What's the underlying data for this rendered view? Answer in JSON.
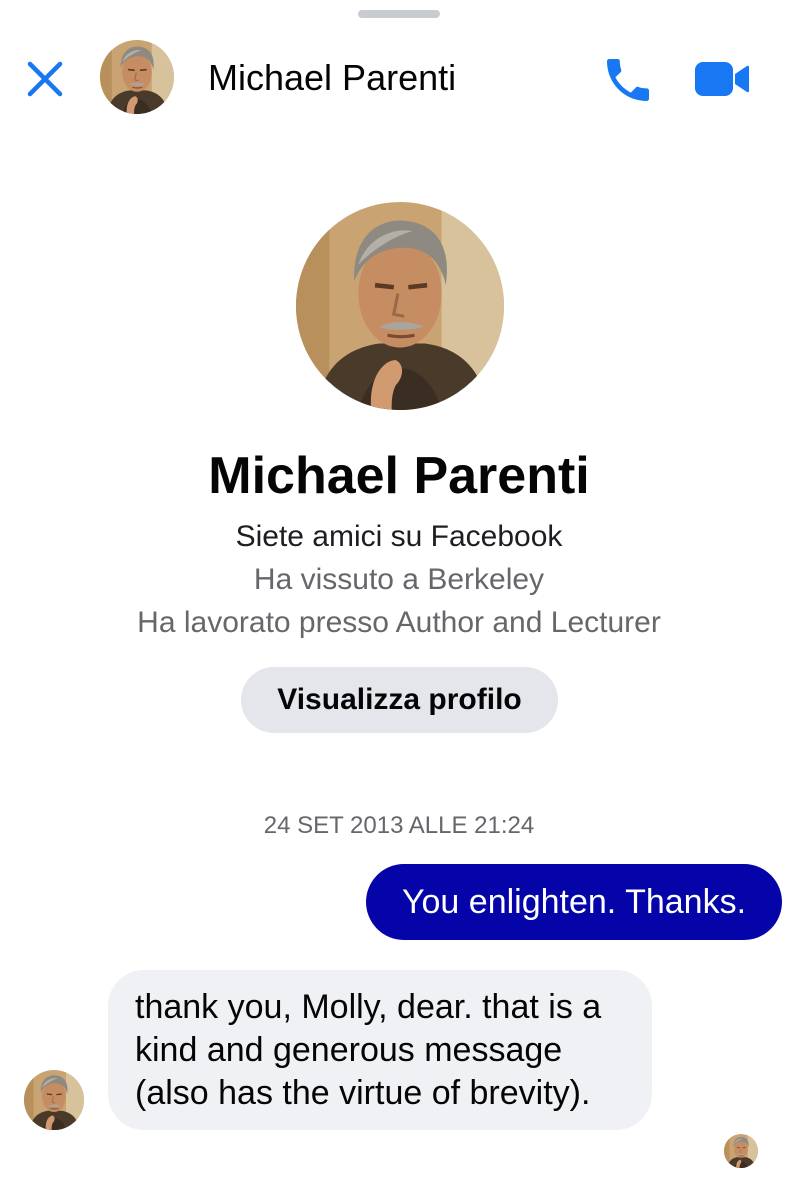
{
  "header": {
    "contact_name": "Michael Parenti",
    "close_icon": "close-icon",
    "call_icon": "phone-icon",
    "video_icon": "video-camera-icon",
    "accent_color": "#1877f2"
  },
  "profile": {
    "name": "Michael Parenti",
    "friends_line": "Siete amici su Facebook",
    "lived_line": "Ha vissuto a Berkeley",
    "worked_line": "Ha lavorato presso Author and Lecturer",
    "view_profile_label": "Visualizza profilo"
  },
  "conversation": {
    "timestamp": "24 SET 2013 ALLE 21:24",
    "messages": [
      {
        "direction": "outgoing",
        "text": "You enlighten. Thanks.",
        "bubble_color": "#0404a8"
      },
      {
        "direction": "incoming",
        "lines": [
          "thank you, Molly, dear. that is a",
          "kind and generous message",
          "(also has the virtue of brevity)."
        ],
        "bubble_color": "#f0f1f4"
      }
    ]
  }
}
